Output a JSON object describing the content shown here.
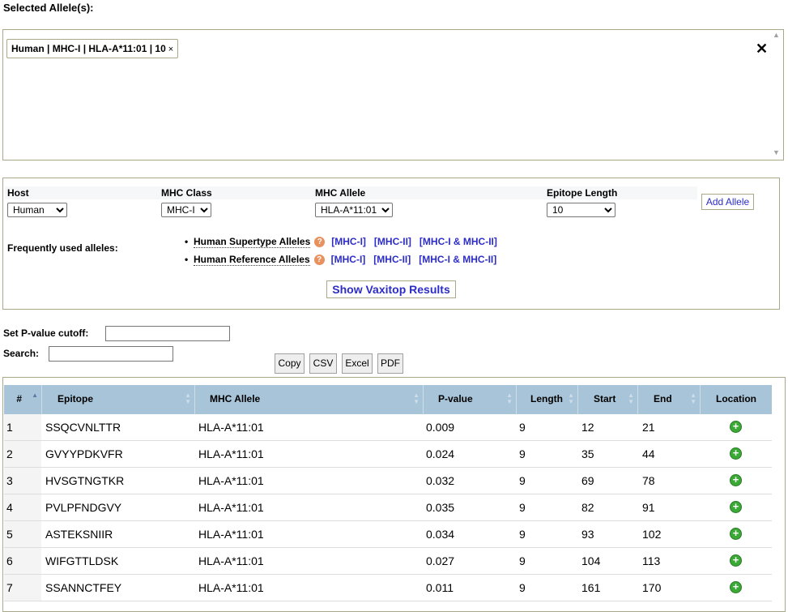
{
  "selected": {
    "title": "Selected Allele(s):",
    "chip_label": "Human | MHC-I | HLA-A*11:01 | 10",
    "chip_remove": "×",
    "clear_all": "✕"
  },
  "form": {
    "host": {
      "label": "Host",
      "value": "Human"
    },
    "mhc_class": {
      "label": "MHC Class",
      "value": "MHC-I"
    },
    "mhc_allele": {
      "label": "MHC Allele",
      "value": "HLA-A*11:01"
    },
    "epitope_length": {
      "label": "Epitope Length",
      "value": "10"
    },
    "add_allele": "Add Allele",
    "frequent_label": "Frequently used alleles:",
    "frequent_rows": [
      {
        "name": "Human Supertype Alleles",
        "help": "?",
        "links": [
          "[MHC-I]",
          "[MHC-II]",
          "[MHC-I & MHC-II]"
        ]
      },
      {
        "name": "Human Reference Alleles",
        "help": "?",
        "links": [
          "[MHC-I]",
          "[MHC-II]",
          "[MHC-I & MHC-II]"
        ]
      }
    ],
    "show_results": "Show Vaxitop Results"
  },
  "filters": {
    "pvalue_label": "Set P-value cutoff:",
    "pvalue_value": "",
    "search_label": "Search:",
    "search_value": ""
  },
  "export_buttons": [
    "Copy",
    "CSV",
    "Excel",
    "PDF"
  ],
  "table": {
    "columns": [
      "#",
      "Epitope",
      "MHC Allele",
      "P-value",
      "Length",
      "Start",
      "End",
      "Location"
    ],
    "sorted_column": "#",
    "sort_direction": "ascending",
    "location_icon": "plus-circle-icon",
    "rows": [
      {
        "num": "1",
        "epitope": "SSQCVNLTTR",
        "allele": "HLA-A*11:01",
        "pvalue": "0.009",
        "length": "9",
        "start": "12",
        "end": "21"
      },
      {
        "num": "2",
        "epitope": "GVYYPDKVFR",
        "allele": "HLA-A*11:01",
        "pvalue": "0.024",
        "length": "9",
        "start": "35",
        "end": "44"
      },
      {
        "num": "3",
        "epitope": "HVSGTNGTKR",
        "allele": "HLA-A*11:01",
        "pvalue": "0.032",
        "length": "9",
        "start": "69",
        "end": "78"
      },
      {
        "num": "4",
        "epitope": "PVLPFNDGVY",
        "allele": "HLA-A*11:01",
        "pvalue": "0.035",
        "length": "9",
        "start": "82",
        "end": "91"
      },
      {
        "num": "5",
        "epitope": "ASTEKSNIIR",
        "allele": "HLA-A*11:01",
        "pvalue": "0.034",
        "length": "9",
        "start": "93",
        "end": "102"
      },
      {
        "num": "6",
        "epitope": "WIFGTTLDSK",
        "allele": "HLA-A*11:01",
        "pvalue": "0.027",
        "length": "9",
        "start": "104",
        "end": "113"
      },
      {
        "num": "7",
        "epitope": "SSANNCTFEY",
        "allele": "HLA-A*11:01",
        "pvalue": "0.011",
        "length": "9",
        "start": "161",
        "end": "170"
      }
    ]
  }
}
